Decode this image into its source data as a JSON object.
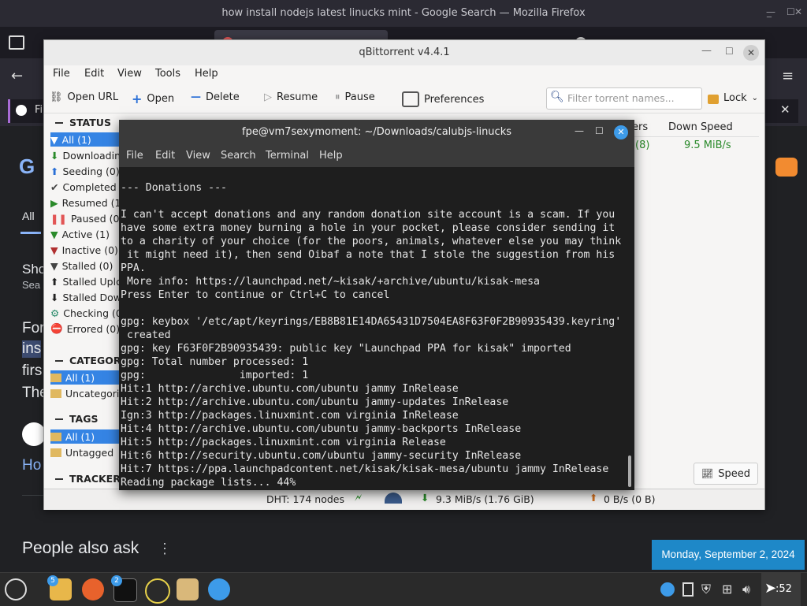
{
  "firefox": {
    "window_title": "how install nodejs latest linucks mint - Google Search — Mozilla Firefox",
    "notice_prefix": "Fi",
    "google": {
      "tab_all": "All",
      "text_sho": "Sho",
      "text_sea": "Sea",
      "text_for": "For",
      "text_ins": "ins",
      "text_firs": "firs",
      "text_the": "The",
      "text_ho": "Ho",
      "people_also_ask": "People also ask"
    }
  },
  "qbittorrent": {
    "title": "qBittorrent v4.4.1",
    "menu": [
      "File",
      "Edit",
      "View",
      "Tools",
      "Help"
    ],
    "toolbar": {
      "open_url": "Open URL",
      "open": "Open",
      "delete": "Delete",
      "resume": "Resume",
      "pause": "Pause",
      "preferences": "Preferences",
      "filter_placeholder": "Filter torrent names...",
      "lock": "Lock"
    },
    "status_header": "STATUS",
    "status_items": [
      {
        "label": "All (1)",
        "icon": "filter-icon"
      },
      {
        "label": "Downloading",
        "icon": "arrow-down-icon"
      },
      {
        "label": "Seeding (0)",
        "icon": "arrow-up-icon"
      },
      {
        "label": "Completed",
        "icon": "checkmark-icon"
      },
      {
        "label": "Resumed (1",
        "icon": "play-icon"
      },
      {
        "label": "Paused (0)",
        "icon": "pause-icon"
      },
      {
        "label": "Active (1)",
        "icon": "filter-icon"
      },
      {
        "label": "Inactive (0)",
        "icon": "filter-icon"
      },
      {
        "label": "Stalled (0)",
        "icon": "filter-icon"
      },
      {
        "label": "Stalled Uplo",
        "icon": "arrow-up-icon"
      },
      {
        "label": "Stalled Dow",
        "icon": "arrow-down-icon"
      },
      {
        "label": "Checking (0)",
        "icon": "gear-icon"
      },
      {
        "label": "Errored (0)",
        "icon": "error-icon"
      }
    ],
    "categories_header": "CATEGORIES",
    "categories": [
      "All (1)",
      "Uncategori"
    ],
    "tags_header": "TAGS",
    "tags": [
      "All (1)",
      "Untagged"
    ],
    "trackers_header": "TRACKERS",
    "columns": {
      "peers_fragment": "ers",
      "down_speed": "Down Speed"
    },
    "row": {
      "peers_fragment": "(8)",
      "down_speed": "9.5 MiB/s"
    },
    "speed_button": "Speed",
    "statusbar": {
      "dht": "DHT: 174 nodes",
      "download": "9.3 MiB/s (1.76 GiB)",
      "upload": "0 B/s (0 B)"
    }
  },
  "terminal": {
    "title": "fpe@vm7sexymoment: ~/Downloads/calubjs-linucks",
    "menu": [
      "File",
      "Edit",
      "View",
      "Search",
      "Terminal",
      "Help"
    ],
    "output": "--- Donations ---\n\nI can't accept donations and any random donation site account is a scam. If you\nhave some extra money burning a hole in your pocket, please consider sending it\nto a charity of your choice (for the poors, animals, whatever else you may think\n it might need it), then send Oibaf a note that I stole the suggestion from his\nPPA.\n More info: https://launchpad.net/~kisak/+archive/ubuntu/kisak-mesa\nPress Enter to continue or Ctrl+C to cancel\n\ngpg: keybox '/etc/apt/keyrings/EB8B81E14DA65431D7504EA8F63F0F2B90935439.keyring'\n created\ngpg: key F63F0F2B90935439: public key \"Launchpad PPA for kisak\" imported\ngpg: Total number processed: 1\ngpg:               imported: 1\nHit:1 http://archive.ubuntu.com/ubuntu jammy InRelease\nHit:2 http://archive.ubuntu.com/ubuntu jammy-updates InRelease\nIgn:3 http://packages.linuxmint.com virginia InRelease\nHit:4 http://archive.ubuntu.com/ubuntu jammy-backports InRelease\nHit:5 http://packages.linuxmint.com virginia Release\nHit:6 http://security.ubuntu.com/ubuntu jammy-security InRelease\nHit:7 https://ppa.launchpadcontent.net/kisak/kisak-mesa/ubuntu jammy InRelease\nReading package lists... 44%"
  },
  "taskbar": {
    "files_badge": "5",
    "terminal_badge": "2",
    "clock_fragment": ":52",
    "date_popup": "Monday, September 2, 2024"
  }
}
